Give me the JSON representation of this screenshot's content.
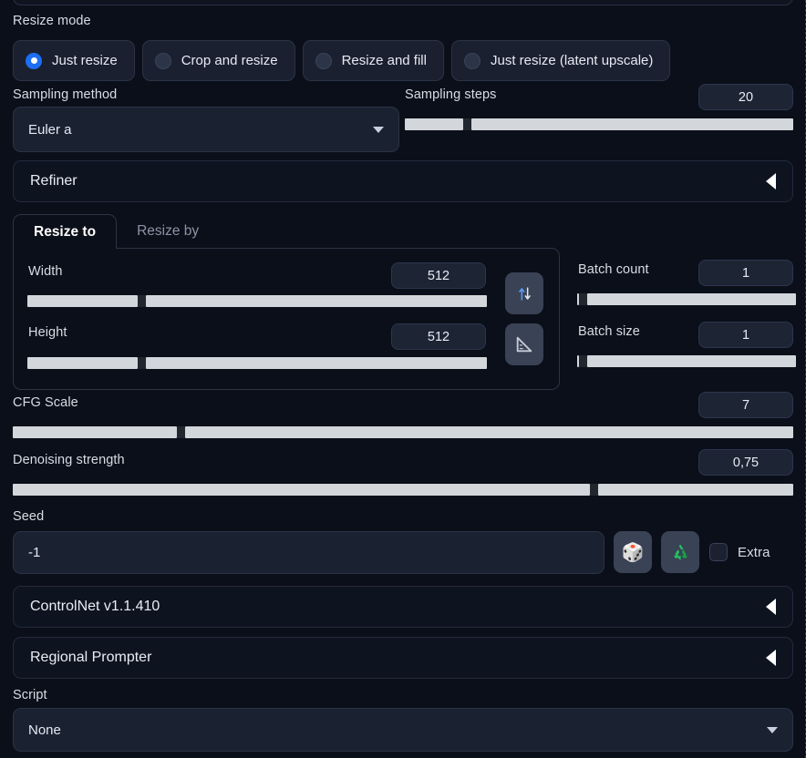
{
  "resize_mode": {
    "label": "Resize mode",
    "options": [
      {
        "label": "Just resize",
        "selected": true
      },
      {
        "label": "Crop and resize",
        "selected": false
      },
      {
        "label": "Resize and fill",
        "selected": false
      },
      {
        "label": "Just resize (latent upscale)",
        "selected": false
      }
    ]
  },
  "sampling": {
    "method_label": "Sampling method",
    "method_value": "Euler a",
    "steps_label": "Sampling steps",
    "steps_value": "20",
    "steps_fill_percent": 15
  },
  "refiner": {
    "title": "Refiner",
    "collapse_icon": "caret-left-icon"
  },
  "resize_tabs": {
    "tabs": [
      {
        "label": "Resize to",
        "active": true
      },
      {
        "label": "Resize by",
        "active": false
      }
    ],
    "width_label": "Width",
    "width_value": "512",
    "width_fill_percent": 24,
    "height_label": "Height",
    "height_value": "512",
    "height_fill_percent": 24,
    "swap_icon": "swap-vertical-icon",
    "ruler_icon": "triangle-ruler-icon"
  },
  "batch": {
    "count_label": "Batch count",
    "count_value": "1",
    "count_fill_percent": 1,
    "size_label": "Batch size",
    "size_value": "1",
    "size_fill_percent": 1
  },
  "cfg": {
    "label": "CFG Scale",
    "value": "7",
    "fill_percent": 21
  },
  "denoising": {
    "label": "Denoising strength",
    "value": "0,75",
    "fill_percent": 74
  },
  "seed": {
    "label": "Seed",
    "value": "-1",
    "dice_icon": "dice-icon",
    "recycle_icon": "recycle-icon",
    "extra_label": "Extra",
    "extra_checked": false
  },
  "extensions": [
    {
      "title": "ControlNet v1.1.410",
      "collapse_icon": "caret-left-icon"
    },
    {
      "title": "Regional Prompter",
      "collapse_icon": "caret-left-icon"
    }
  ],
  "script": {
    "label": "Script",
    "value": "None",
    "caret_icon": "caret-down-icon"
  },
  "colors": {
    "background": "#0b0f19",
    "accent_blue": "#1c6ef2",
    "slider_track": "#d3d6da",
    "panel": "#1a2131",
    "border": "#2b3346"
  }
}
